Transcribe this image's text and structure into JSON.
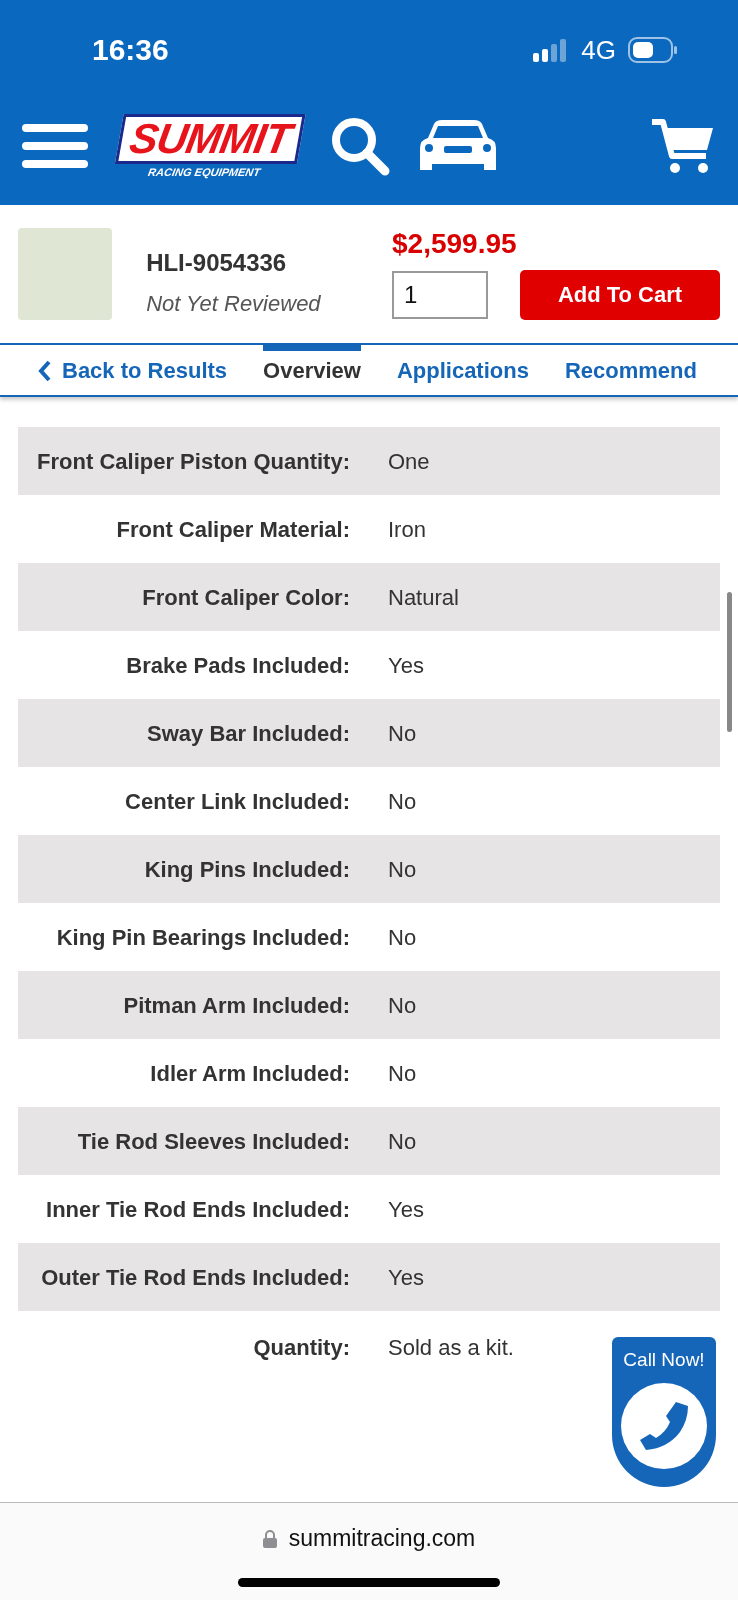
{
  "status_bar": {
    "time": "16:36",
    "network": "4G"
  },
  "header": {
    "logo": {
      "name": "SUMMIT",
      "tagline": "RACING EQUIPMENT"
    }
  },
  "product": {
    "part_number": "HLI-9054336",
    "reviews": "Not Yet Reviewed",
    "price": "$2,599.95",
    "quantity": "1",
    "add_button": "Add To Cart"
  },
  "tabs": [
    {
      "label": "Back to Results",
      "kind": "back",
      "selected": false
    },
    {
      "label": "Overview",
      "kind": "tab",
      "selected": true
    },
    {
      "label": "Applications",
      "kind": "tab",
      "selected": false
    },
    {
      "label": "Recommend",
      "kind": "tab",
      "selected": false
    }
  ],
  "specs": [
    {
      "label": "Front Caliper Piston Quantity:",
      "value": "One"
    },
    {
      "label": "Front Caliper Material:",
      "value": "Iron"
    },
    {
      "label": "Front Caliper Color:",
      "value": "Natural"
    },
    {
      "label": "Brake Pads Included:",
      "value": "Yes"
    },
    {
      "label": "Sway Bar Included:",
      "value": "No"
    },
    {
      "label": "Center Link Included:",
      "value": "No"
    },
    {
      "label": "King Pins Included:",
      "value": "No"
    },
    {
      "label": "King Pin Bearings Included:",
      "value": "No"
    },
    {
      "label": "Pitman Arm Included:",
      "value": "No"
    },
    {
      "label": "Idler Arm Included:",
      "value": "No"
    },
    {
      "label": "Tie Rod Sleeves Included:",
      "value": "No"
    },
    {
      "label": "Inner Tie Rod Ends Included:",
      "value": "Yes"
    },
    {
      "label": "Outer Tie Rod Ends Included:",
      "value": "Yes"
    },
    {
      "label": "Quantity:",
      "value": "Sold as a kit."
    }
  ],
  "call_button": {
    "label": "Call Now!"
  },
  "browser": {
    "url": "summitracing.com"
  }
}
